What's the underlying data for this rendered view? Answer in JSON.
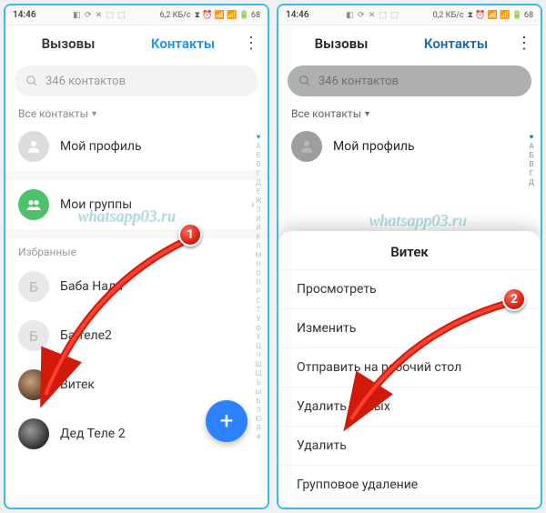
{
  "status": {
    "time": "14:46",
    "icons_left": "◧ ⟳ ✕ ⬚ ⬚",
    "net_speed1": "6,2 КБ/с",
    "net_speed2": "0,2 КБ/с",
    "icons_right": "⧗ ⏰ 📶 📶 🔋 68"
  },
  "tabs": {
    "calls": "Вызовы",
    "contacts": "Контакты"
  },
  "search": {
    "placeholder": "346 контактов"
  },
  "filter": {
    "label": "Все контакты"
  },
  "rows": {
    "profile": "Мой профиль",
    "groups": "Мои группы",
    "section_fav": "Избранные"
  },
  "contacts": [
    {
      "letter": "Б",
      "name": "Баба Надя"
    },
    {
      "letter": "Б",
      "name": "Баланс теле2",
      "name_partial": "Ба         теле2"
    },
    {
      "avatar": "img",
      "name": "Витек"
    },
    {
      "avatar": "img2",
      "name": "Дед Теле 2"
    }
  ],
  "alpha": [
    "♥",
    "А",
    "Б",
    "В",
    "Г",
    "Д",
    "Е",
    "Ж",
    "З",
    "И",
    "Й",
    "К",
    "Л",
    "М",
    "Н",
    "О",
    "П",
    "Р",
    "С",
    "Т",
    "У",
    "Ф",
    "Х",
    "Ц",
    "Ч",
    "Ш",
    "Щ",
    "Ъ",
    "Ы",
    "Ь",
    "Э",
    "Ю",
    "Я",
    "#"
  ],
  "sheet": {
    "title": "Витек",
    "options": [
      "Просмотреть",
      "Изменить",
      "Отправить на рабочий стол",
      "Удалить из избранных",
      "Удалить",
      "Групповое удаление"
    ],
    "options_partial": [
      "Просмотреть",
      "Изменить",
      "Отправить на рабочий стол",
      "Удалить из         ных",
      "Удалить",
      "Групповое удаление"
    ]
  },
  "watermark": "whatsapp03.ru",
  "callouts": {
    "n1": "1",
    "n2": "2"
  }
}
